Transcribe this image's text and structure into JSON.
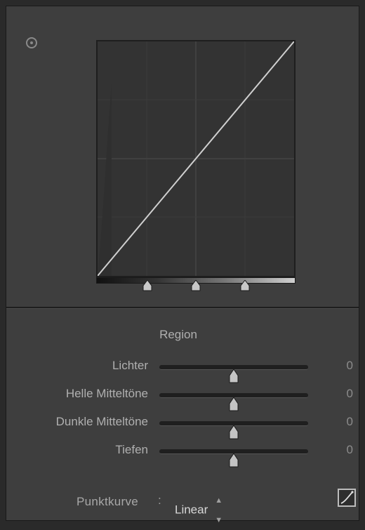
{
  "panel": {
    "target_icon": "target-adjustment-icon",
    "curve_graph": {
      "curve_type": "linear",
      "handles": [
        0.25,
        0.5,
        0.75
      ]
    }
  },
  "region": {
    "title": "Region",
    "sliders": [
      {
        "label": "Lichter",
        "value": "0",
        "level": 0.5
      },
      {
        "label": "Helle Mitteltöne",
        "value": "0",
        "level": 0.5
      },
      {
        "label": "Dunkle Mitteltöne",
        "value": "0",
        "level": 0.5
      },
      {
        "label": "Tiefen",
        "value": "0",
        "level": 0.5
      }
    ]
  },
  "footer": {
    "label": "Punktkurve",
    "colon": ":",
    "selected": "Linear",
    "selector_icon": "up-down-arrows-icon",
    "edit_button_icon": "edit-point-curve-icon"
  },
  "colors": {
    "panel_bg": "#3e3e3e",
    "graph_bg": "#333333",
    "curve_line": "#d0d0d0"
  }
}
